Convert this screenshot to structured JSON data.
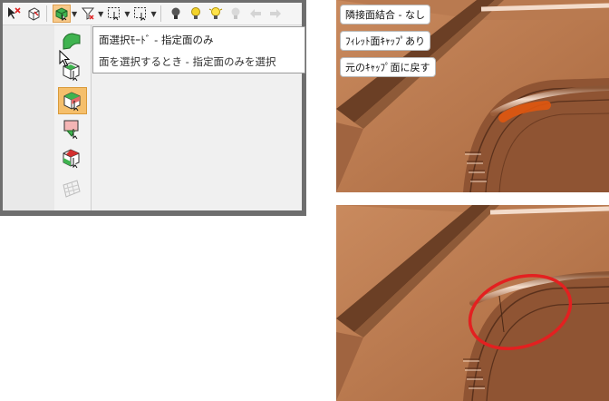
{
  "toolbar": {
    "buttons": [
      {
        "icon": "select-pointer-x-icon"
      },
      {
        "icon": "select-solid-icon"
      },
      {
        "icon": "face-select-mode-icon",
        "active": true
      },
      {
        "icon": "filter-funnel-icon"
      },
      {
        "icon": "box-select-icon"
      },
      {
        "icon": "box-select-cross-icon"
      },
      {
        "icon": "light-bulb-dark-icon"
      },
      {
        "icon": "light-bulb-icon"
      },
      {
        "icon": "light-bulb-lit-icon"
      },
      {
        "icon": "light-bulb-disabled-icon"
      },
      {
        "icon": "arrow-left-icon"
      },
      {
        "icon": "arrow-right-icon"
      }
    ]
  },
  "flyout": {
    "items": [
      {
        "icon": "face-green-icon",
        "selected": false
      },
      {
        "icon": "face-connected-icon",
        "selected": false
      },
      {
        "icon": "face-tangent-icon",
        "selected": true
      },
      {
        "icon": "face-pink-icon",
        "selected": false
      },
      {
        "icon": "face-red-corner-icon",
        "selected": false
      },
      {
        "icon": "face-mesh-icon",
        "selected": false
      }
    ]
  },
  "tooltip": {
    "title": "面選択ﾓｰﾄﾞ - 指定面のみ",
    "description": "面を選択するとき - 指定面のみを選択"
  },
  "view_top": {
    "labels": [
      "隣接面結合 - なし",
      "ﾌｨﾚｯﾄ面ｷｬｯﾌﾟあり",
      "元のｷｬｯﾌﾟ面に戻す"
    ]
  },
  "colors": {
    "model_copper": "#b8744a",
    "highlight_orange": "#e0560e",
    "annotation_red": "#e32020",
    "selected_button": "#f5bf6b"
  }
}
